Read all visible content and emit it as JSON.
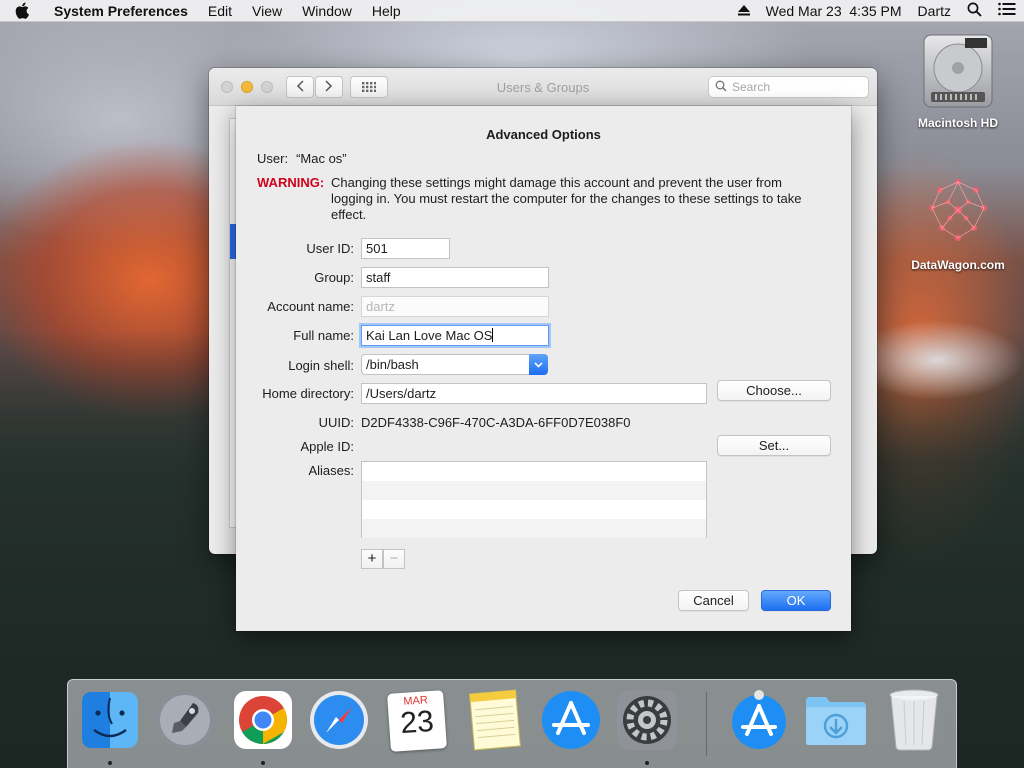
{
  "menubar": {
    "app_name": "System Preferences",
    "menus": [
      "Edit",
      "View",
      "Window",
      "Help"
    ],
    "datetime": "Wed Mar 23  4:35 PM",
    "user": "Dartz"
  },
  "desktop": {
    "icons": [
      {
        "label": "Macintosh HD",
        "icon": "hard-drive-icon"
      },
      {
        "label": "DataWagon.com",
        "icon": "network-graphic-icon"
      }
    ]
  },
  "window": {
    "title": "Users & Groups",
    "search_placeholder": "Search"
  },
  "sheet": {
    "title": "Advanced Options",
    "user_label": "User:",
    "user_value": "“Mac os”",
    "warning_label": "WARNING:",
    "warning_text": "Changing these settings might damage this account and prevent the user from logging in. You must restart the computer for the changes to these settings to take effect.",
    "fields": {
      "user_id": {
        "label": "User ID:",
        "value": "501"
      },
      "group": {
        "label": "Group:",
        "value": "staff"
      },
      "account_name": {
        "label": "Account name:",
        "value": "dartz"
      },
      "full_name": {
        "label": "Full name:",
        "value": "Kai Lan Love Mac OS"
      },
      "login_shell": {
        "label": "Login shell:",
        "value": "/bin/bash"
      },
      "home_directory": {
        "label": "Home directory:",
        "value": "/Users/dartz"
      },
      "uuid": {
        "label": "UUID:",
        "value": "D2DF4338-C96F-470C-A3DA-6FF0D7E038F0"
      },
      "apple_id": {
        "label": "Apple ID:"
      },
      "aliases": {
        "label": "Aliases:"
      }
    },
    "buttons": {
      "choose": "Choose...",
      "set": "Set...",
      "add": "+",
      "remove": "−",
      "cancel": "Cancel",
      "ok": "OK"
    }
  },
  "dock": {
    "calendar_month": "MAR",
    "calendar_day": "23",
    "items": [
      "finder-icon",
      "launchpad-icon",
      "chrome-icon",
      "safari-icon",
      "calendar-icon",
      "notes-icon",
      "app-store-icon",
      "system-preferences-icon",
      "app-store-installer-icon",
      "downloads-folder-icon",
      "trash-icon"
    ]
  },
  "colors": {
    "accent": "#1d6ff2",
    "warning": "#d0021b",
    "focus_ring": "#a3c8f7"
  }
}
